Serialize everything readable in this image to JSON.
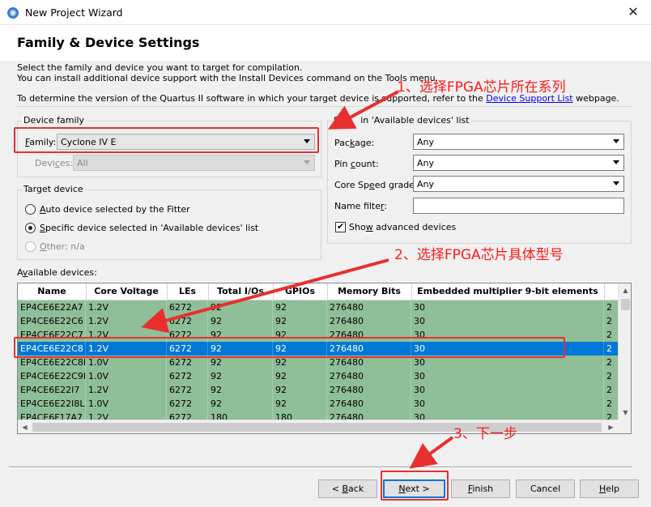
{
  "window": {
    "title": "New Project Wizard",
    "close_glyph": "✕"
  },
  "page": {
    "heading": "Family & Device Settings",
    "intro_line1": "Select the family and device you want to target for compilation.",
    "intro_line2": "You can install additional device support with the Install Devices command on the Tools menu.",
    "version_text_before": "To determine the version of the Quartus II software in which your target device is supported, refer to the",
    "version_link": "Device Support List",
    "version_text_after": "webpage."
  },
  "device_family": {
    "legend": "Device family",
    "family_label_mnemonic": "F",
    "family_label_rest": "amily:",
    "family_value": "Cyclone IV E",
    "devices_label_before": "Devi",
    "devices_label_mnemonic": "c",
    "devices_label_after": "es:",
    "devices_value": "All"
  },
  "target_device": {
    "legend": "Target device",
    "auto_mnemonic": "A",
    "auto_rest": "uto device selected by the Fitter",
    "specific_mnemonic": "S",
    "specific_rest": "pecific device selected in 'Available devices' list",
    "other_mnemonic": "O",
    "other_rest": "ther:",
    "other_value": "n/a",
    "selected": "specific"
  },
  "filters": {
    "legend_partial": "in 'Available devices' list",
    "legend_visible": "Sho",
    "package_label_before": "Pac",
    "package_label_mnemonic": "k",
    "package_label_after": "age:",
    "package_value": "Any",
    "pincount_label_before": "Pin ",
    "pincount_label_mnemonic": "c",
    "pincount_label_after": "ount:",
    "pincount_value": "Any",
    "speed_label_before": "Core Sp",
    "speed_label_mnemonic": "e",
    "speed_label_after": "ed grade:",
    "speed_value": "Any",
    "namefilter_label_before": "Name filte",
    "namefilter_label_mnemonic": "r",
    "namefilter_label_after": ":",
    "namefilter_value": "",
    "show_advanced_before": "Sho",
    "show_advanced_mnemonic": "w",
    "show_advanced_after": " advanced devices",
    "show_advanced_checked": true
  },
  "available_devices": {
    "label_before": "A",
    "label_mnemonic": "v",
    "label_after": "ailable devices:",
    "columns": [
      "Name",
      "Core Voltage",
      "LEs",
      "Total I/Os",
      "GPIOs",
      "Memory Bits",
      "Embedded multiplier 9-bit elements",
      ""
    ],
    "rows": [
      [
        "EP4CE6E22A7",
        "1.2V",
        "6272",
        "92",
        "92",
        "276480",
        "30",
        "2"
      ],
      [
        "EP4CE6E22C6",
        "1.2V",
        "6272",
        "92",
        "92",
        "276480",
        "30",
        "2"
      ],
      [
        "EP4CE6E22C7",
        "1.2V",
        "6272",
        "92",
        "92",
        "276480",
        "30",
        "2"
      ],
      [
        "EP4CE6E22C8",
        "1.2V",
        "6272",
        "92",
        "92",
        "276480",
        "30",
        "2"
      ],
      [
        "EP4CE6E22C8L",
        "1.0V",
        "6272",
        "92",
        "92",
        "276480",
        "30",
        "2"
      ],
      [
        "EP4CE6E22C9L",
        "1.0V",
        "6272",
        "92",
        "92",
        "276480",
        "30",
        "2"
      ],
      [
        "EP4CE6E22I7",
        "1.2V",
        "6272",
        "92",
        "92",
        "276480",
        "30",
        "2"
      ],
      [
        "EP4CE6E22I8L",
        "1.0V",
        "6272",
        "92",
        "92",
        "276480",
        "30",
        "2"
      ],
      [
        "EP4CE6F17A7",
        "1.2V",
        "6272",
        "180",
        "180",
        "276480",
        "30",
        "2"
      ]
    ],
    "selected_row": 3
  },
  "buttons": {
    "back_prefix": "< ",
    "back_mnemonic": "B",
    "back_rest": "ack",
    "next_mnemonic": "N",
    "next_rest": "ext >",
    "finish_mnemonic": "F",
    "finish_rest": "inish",
    "cancel": "Cancel",
    "help_mnemonic": "H",
    "help_rest": "elp"
  },
  "annotations": {
    "step1": "1、选择FPGA芯片所在系列",
    "step2": "2、选择FPGA芯片具体型号",
    "step3": "3、下一步",
    "color": "#e82f2f"
  }
}
